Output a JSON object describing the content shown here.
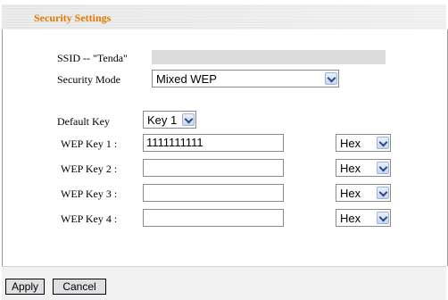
{
  "header": {
    "title": "Security Settings"
  },
  "ssid_label": "SSID -- \"Tenda\"",
  "security_mode": {
    "label": "Security Mode",
    "value": "Mixed WEP"
  },
  "default_key": {
    "label": "Default Key",
    "value": "Key 1"
  },
  "wep_keys": [
    {
      "label": "WEP Key 1 :",
      "value": "1111111111",
      "format": "Hex"
    },
    {
      "label": "WEP Key 2 :",
      "value": "",
      "format": "Hex"
    },
    {
      "label": "WEP Key 3 :",
      "value": "",
      "format": "Hex"
    },
    {
      "label": "WEP Key 4 :",
      "value": "",
      "format": "Hex"
    }
  ],
  "buttons": {
    "apply": "Apply",
    "cancel": "Cancel"
  },
  "colors": {
    "title": "#e07b00",
    "band": "#dcdcdc"
  }
}
